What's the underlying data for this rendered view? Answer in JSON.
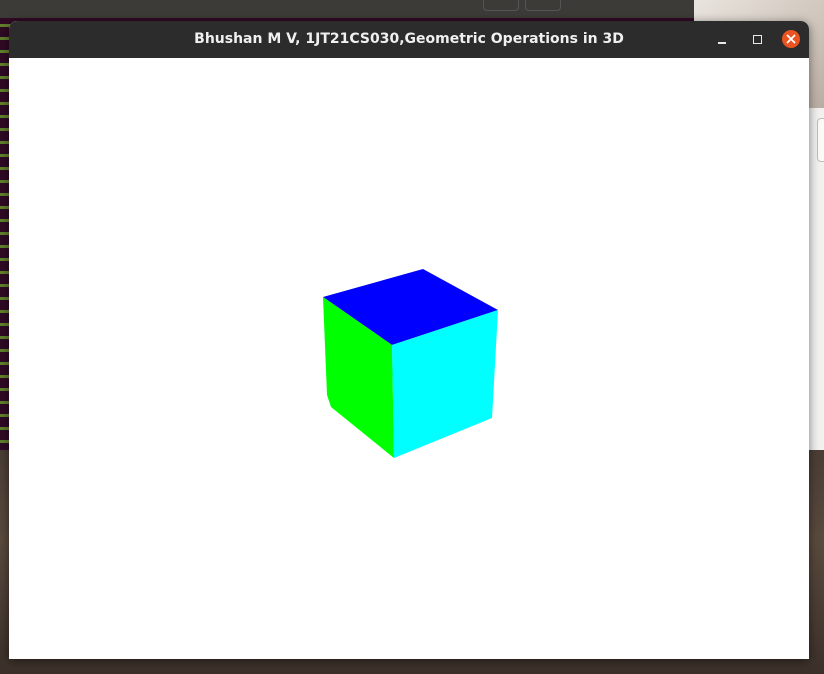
{
  "window": {
    "title": "Bhushan M V, 1JT21CS030,Geometric Operations in 3D",
    "controls": {
      "minimize": "minimize-icon",
      "maximize": "maximize-icon",
      "close": "close-icon"
    },
    "colors": {
      "titlebar": "#2c2c2c",
      "close_button": "#e95420",
      "canvas_background": "#ffffff"
    }
  },
  "scene": {
    "object": "cube",
    "faces": [
      {
        "name": "top",
        "color": "#0000ff"
      },
      {
        "name": "left",
        "color": "#00ff00"
      },
      {
        "name": "right",
        "color": "#00ffff"
      }
    ]
  }
}
